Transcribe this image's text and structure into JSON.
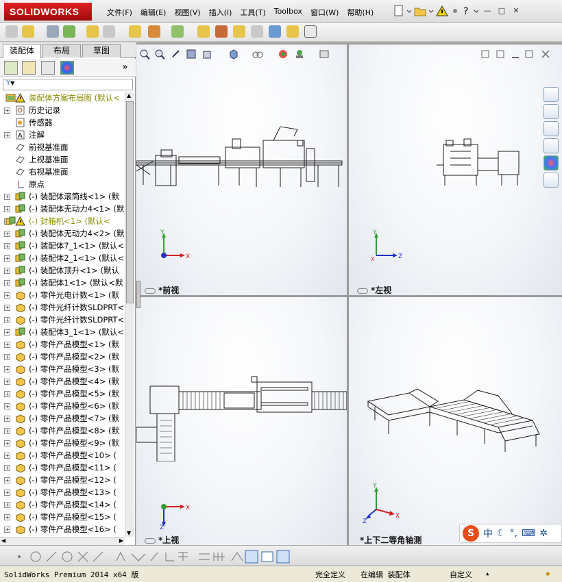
{
  "app": {
    "brand": "SOLIDWORKS"
  },
  "menu": [
    "文件(F)",
    "编辑(E)",
    "视图(V)",
    "插入(I)",
    "工具(T)",
    "Toolbox",
    "窗口(W)",
    "帮助(H)"
  ],
  "left_panel": {
    "tabs": [
      "装配体",
      "布局",
      "草图"
    ],
    "filter_symbol": "▼",
    "tree": [
      {
        "label": "装配体方案布局图 (默认<",
        "kind": "root",
        "warn": true
      },
      {
        "label": "历史记录",
        "kind": "history",
        "exp": "+"
      },
      {
        "label": "传感器",
        "kind": "sensor"
      },
      {
        "label": "注解",
        "kind": "annotation",
        "exp": "+"
      },
      {
        "label": "前视基准面",
        "kind": "plane"
      },
      {
        "label": "上视基准面",
        "kind": "plane"
      },
      {
        "label": "右视基准面",
        "kind": "plane"
      },
      {
        "label": "原点",
        "kind": "origin"
      },
      {
        "label": "(-) 装配体滚筒线<1> (默",
        "kind": "assembly",
        "exp": "+"
      },
      {
        "label": "(-) 装配体无动力4<1> (默",
        "kind": "assembly",
        "exp": "+"
      },
      {
        "label": "(-) 封箱机<1> (默认<",
        "kind": "assembly",
        "exp": "+",
        "warn": true
      },
      {
        "label": "(-) 装配体无动力4<2> (默",
        "kind": "assembly",
        "exp": "+"
      },
      {
        "label": "(-) 装配体7_1<1> (默认<",
        "kind": "assembly",
        "exp": "+"
      },
      {
        "label": "(-) 装配体2_1<1> (默认<",
        "kind": "assembly",
        "exp": "+"
      },
      {
        "label": "(-) 装配体顶升<1> (默认",
        "kind": "assembly",
        "exp": "+"
      },
      {
        "label": "(-) 装配体1<1> (默认<默",
        "kind": "assembly",
        "exp": "+"
      },
      {
        "label": "(-) 零件光电计数<1> (默",
        "kind": "part",
        "exp": "+"
      },
      {
        "label": "(-) 零件光纤计数SLDPRT<",
        "kind": "part",
        "exp": "+"
      },
      {
        "label": "(-) 零件光纤计数SLDPRT<",
        "kind": "part",
        "exp": "+"
      },
      {
        "label": "(-) 装配体3_1<1> (默认<",
        "kind": "assembly",
        "exp": "+"
      },
      {
        "label": "(-) 零件产品模型<1> (默",
        "kind": "part",
        "exp": "+"
      },
      {
        "label": "(-) 零件产品模型<2> (默",
        "kind": "part",
        "exp": "+"
      },
      {
        "label": "(-) 零件产品模型<3> (默",
        "kind": "part",
        "exp": "+"
      },
      {
        "label": "(-) 零件产品模型<4> (默",
        "kind": "part",
        "exp": "+"
      },
      {
        "label": "(-) 零件产品模型<5> (默",
        "kind": "part",
        "exp": "+"
      },
      {
        "label": "(-) 零件产品模型<6> (默",
        "kind": "part",
        "exp": "+"
      },
      {
        "label": "(-) 零件产品模型<7> (默",
        "kind": "part",
        "exp": "+"
      },
      {
        "label": "(-) 零件产品模型<8> (默",
        "kind": "part",
        "exp": "+"
      },
      {
        "label": "(-) 零件产品模型<9> (默",
        "kind": "part",
        "exp": "+"
      },
      {
        "label": "(-) 零件产品模型<10> (",
        "kind": "part",
        "exp": "+"
      },
      {
        "label": "(-) 零件产品模型<11> (",
        "kind": "part",
        "exp": "+"
      },
      {
        "label": "(-) 零件产品模型<12> (",
        "kind": "part",
        "exp": "+"
      },
      {
        "label": "(-) 零件产品模型<13> (",
        "kind": "part",
        "exp": "+"
      },
      {
        "label": "(-) 零件产品模型<14> (",
        "kind": "part",
        "exp": "+"
      },
      {
        "label": "(-) 零件产品模型<15> (",
        "kind": "part",
        "exp": "+"
      },
      {
        "label": "(-) 零件产品模型<16> (",
        "kind": "part",
        "exp": "+"
      }
    ]
  },
  "views": {
    "front": "*前视",
    "left": "*左视",
    "top": "*上视",
    "iso": "*上下二等角轴测"
  },
  "axes": {
    "x": "X",
    "y": "Y",
    "z": "Z"
  },
  "ime": {
    "logo": "S",
    "lang": "中"
  },
  "status": {
    "product": "SolidWorks Premium 2014 x64 版",
    "definition": "完全定义",
    "mode": "在编辑 装配体",
    "units": "自定义"
  },
  "colors": {
    "brand_red": "#c81414",
    "viewport_bg": "#eef1f6",
    "warn": "#8a8a00"
  }
}
